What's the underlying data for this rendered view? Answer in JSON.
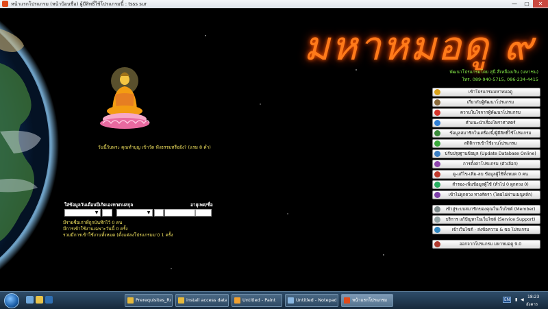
{
  "window": {
    "title": "หน้าแรกโปรแกรม (หน้าป้อนชื่อ) ผู้มีสิทธิ์ใช้โปรแกรมนี้ : tsss        sur",
    "min": "—",
    "max": "▢",
    "close": "✕"
  },
  "app": {
    "logo": "มหาหมอดู ๙",
    "developer": "พัฒนาโปรแกรมโดย สุนี สีเหลืองเกิน (มหาชน)",
    "phone": "โทร. 089-940-5715, 086-234-4415",
    "greeting": "วันนี้วันพระ คุณทำบุญ เข้าวัด ฟังธรรมหรือยัง? (แรม 8 ค่ำ)"
  },
  "form": {
    "label_name": "ใส่ข้อมูลวันเดือนปีเกิดเองทาง",
    "label_surname": "นามสกุล",
    "label_age": "อายุเพศ/ชื่อ",
    "stats": [
      "มีรายชื่อเก่าที่ถูกบันทึกไว้ 0 คน",
      "มีการเข้าใช้งานเฉพาะวันนี้ 0 ครั้ง",
      "รวมมีการเข้าใช้งานทั้งหมด (ตั้งแต่ลงโปรแกรมมา) 1 ครั้ง"
    ]
  },
  "menu": [
    {
      "label": "เข้าโปรแกรมมหาหมอดู",
      "icon": "gold-coin-icon",
      "color": "#d9a21a"
    },
    {
      "label": "เกี่ยวกับผู้พัฒนาโปรแกรม",
      "icon": "people-icon",
      "color": "#8a6a3a"
    },
    {
      "label": "ความในใจจากผู้พัฒนาโปรแกรม",
      "icon": "heart-icon",
      "color": "#d8342a"
    },
    {
      "label": "คำแนะนำเรื่องโหราศาสตร์",
      "icon": "help-icon",
      "color": "#2f7fd6"
    },
    {
      "label": "ข้อมูลสมาชิกในเครื่องนี้/ผู้มีสิทธิ์ใช้โปรแกรม",
      "icon": "computer-icon",
      "color": "#3a8a3a"
    },
    {
      "label": "สถิติการเข้าใช้งานโปรแกรม",
      "icon": "chart-icon",
      "color": "#3aa83a"
    },
    {
      "label": "ปรับปรุงฐานข้อมูล (Update Database Online)",
      "icon": "database-icon",
      "color": "#3b7fc4"
    },
    {
      "label": "การตั้งค่าโปรแกรม (ตัวเลือก)",
      "icon": "tools-icon",
      "color": "#8e44ad"
    },
    {
      "label": "ดู-แก้ไข-เพิ่ม-ลบ ข้อมูลผู้ใช้ทั้งหมด 0 คน",
      "icon": "users-icon",
      "color": "#c0392b"
    },
    {
      "label": "สำรอง-เพิ่มข้อมูลผู้ใช้ (ทั่วไป 0    ผูกดวง 0)",
      "icon": "backup-icon",
      "color": "#27ae60"
    },
    {
      "label": "เข้าไปผูกดวง ทางศัตรา (โดยไม่ผ่านเมนูหลัก)",
      "icon": "wheel-icon",
      "color": "#7d3fa8"
    },
    {
      "label": "เข้าสู่ระบบสมาชิกของคุณในเว็บไซต์ (Member)",
      "icon": "lock-icon",
      "color": "#7f8c8d"
    },
    {
      "label": "บริการ แก้ปัญหาในเว็บไซต์ (Service Support)",
      "icon": "tool-icon",
      "color": "#95a5a6"
    },
    {
      "label": "เข้าเว็บไซต์ - ส่งข้อความ & ขอ โปรแกรม",
      "icon": "globe-icon",
      "color": "#2e86c1"
    },
    {
      "label": "ออกจากโปรแกรม มหาหมอดู 9.0",
      "icon": "exit-icon",
      "color": "#b03a2e"
    }
  ],
  "taskbar": {
    "items": [
      {
        "label": "Prerequisites_Ru...",
        "color": "#e6b93c",
        "active": false
      },
      {
        "label": "install access data",
        "color": "#e6b93c",
        "active": false
      },
      {
        "label": "Untitled - Paint",
        "color": "#f0a030",
        "active": false
      },
      {
        "label": "Untitled - Notepad",
        "color": "#89b6e0",
        "active": false
      },
      {
        "label": "หน้าแรกโปรแกรม",
        "color": "#e14b1b",
        "active": true
      }
    ],
    "lang": "EN",
    "time": "18:23",
    "day": "อังคาร"
  }
}
